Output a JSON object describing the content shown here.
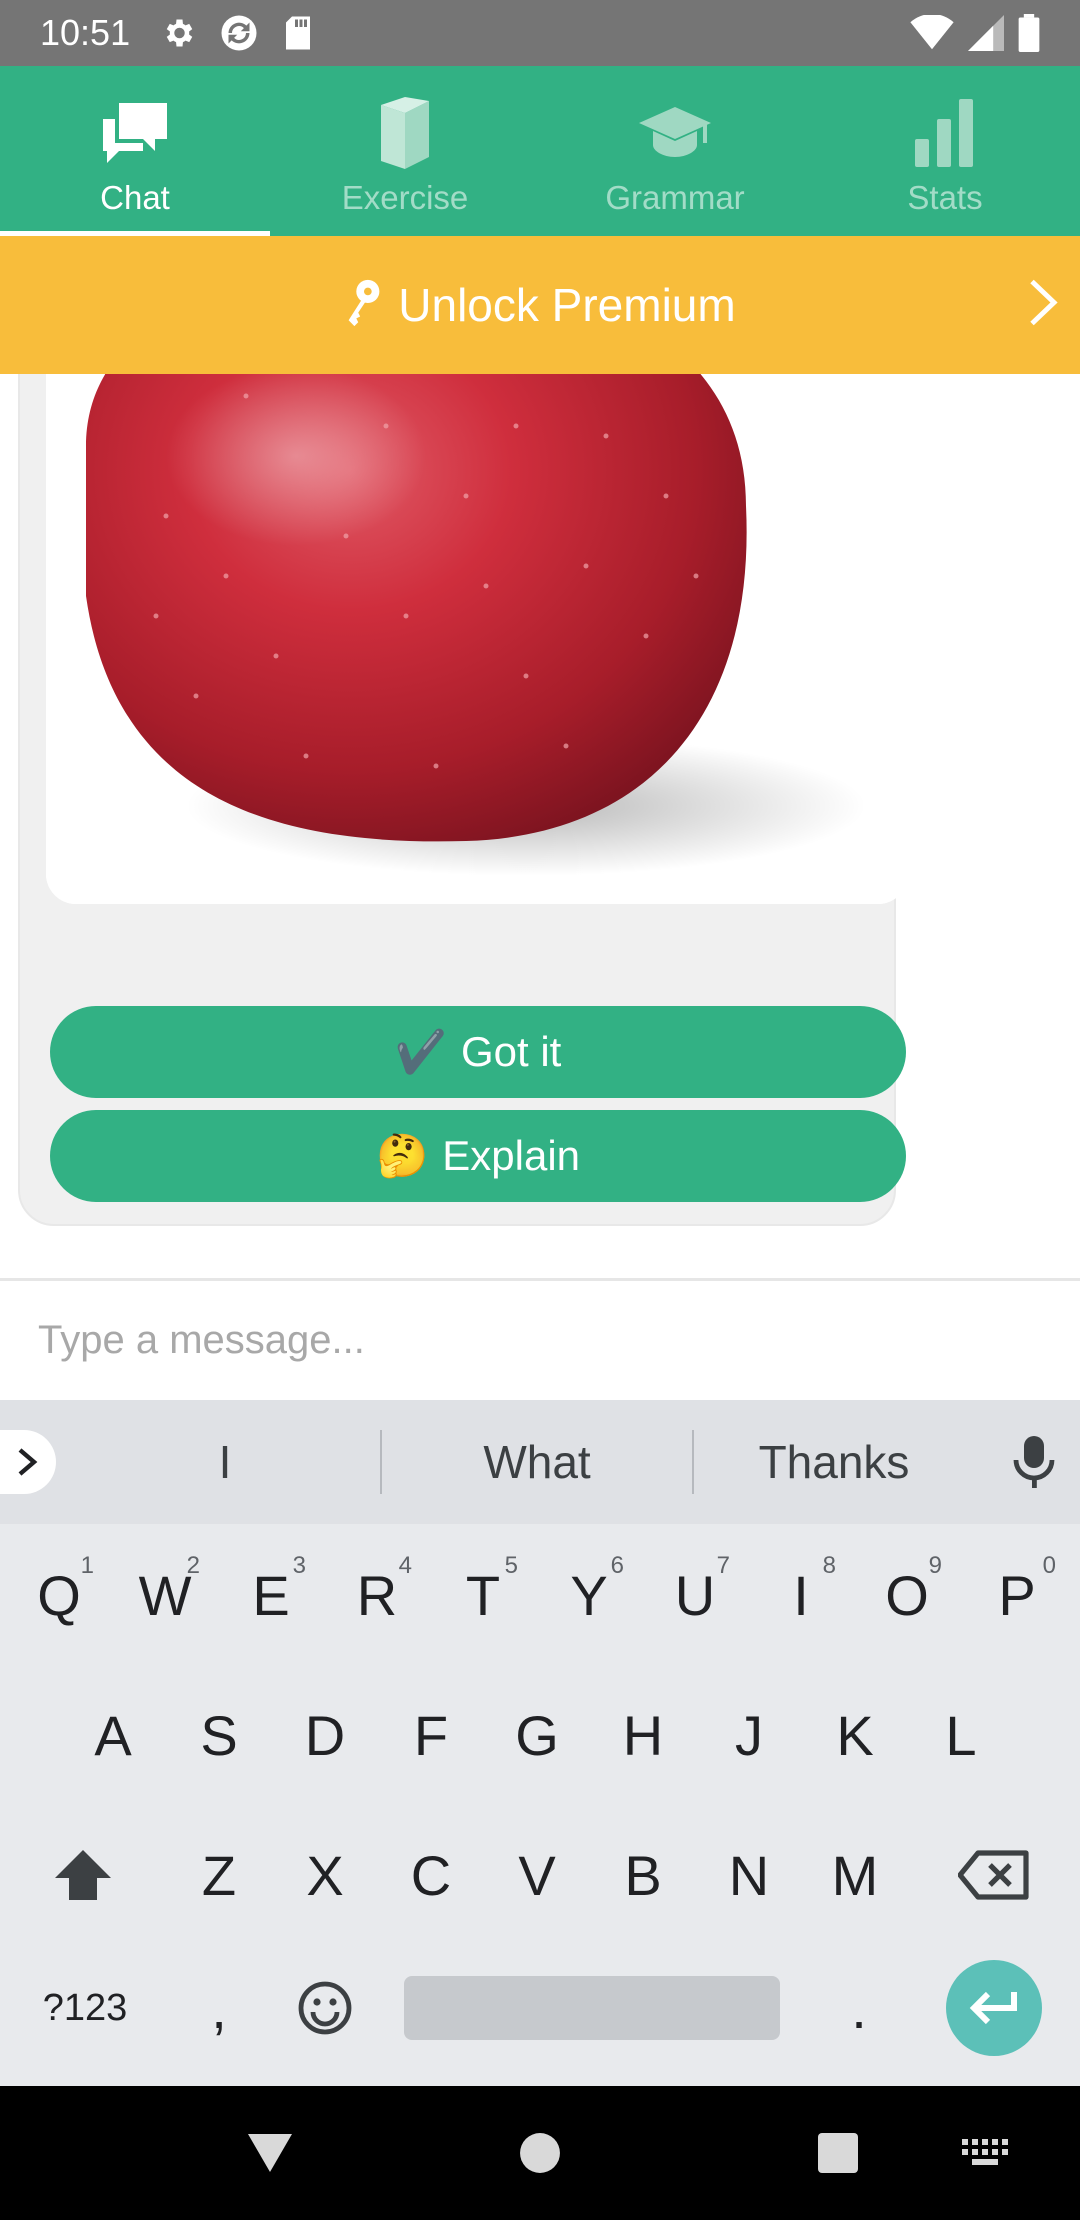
{
  "status_bar": {
    "time": "10:51",
    "icons_left": [
      "gear-icon",
      "sync-icon",
      "sd-card-icon"
    ],
    "icons_right": [
      "wifi-icon",
      "signal-icon",
      "battery-icon"
    ]
  },
  "nav": {
    "tabs": [
      {
        "label": "Chat",
        "icon": "chat-bubbles-icon",
        "active": true
      },
      {
        "label": "Exercise",
        "icon": "book-icon",
        "active": false
      },
      {
        "label": "Grammar",
        "icon": "graduation-cap-icon",
        "active": false
      },
      {
        "label": "Stats",
        "icon": "bar-chart-icon",
        "active": false
      }
    ]
  },
  "premium": {
    "label": "Unlock Premium",
    "icon": "key-icon"
  },
  "chat": {
    "image_alt": "red apple",
    "buttons": {
      "got_it": {
        "emoji": "✔️",
        "label": "Got it"
      },
      "explain": {
        "emoji": "🤔",
        "label": "Explain"
      }
    }
  },
  "input": {
    "placeholder": "Type a message..."
  },
  "keyboard": {
    "suggestions": [
      "I",
      "What",
      "Thanks"
    ],
    "row1": [
      {
        "key": "Q",
        "hint": "1"
      },
      {
        "key": "W",
        "hint": "2"
      },
      {
        "key": "E",
        "hint": "3"
      },
      {
        "key": "R",
        "hint": "4"
      },
      {
        "key": "T",
        "hint": "5"
      },
      {
        "key": "Y",
        "hint": "6"
      },
      {
        "key": "U",
        "hint": "7"
      },
      {
        "key": "I",
        "hint": "8"
      },
      {
        "key": "O",
        "hint": "9"
      },
      {
        "key": "P",
        "hint": "0"
      }
    ],
    "row2": [
      "A",
      "S",
      "D",
      "F",
      "G",
      "H",
      "J",
      "K",
      "L"
    ],
    "row3": [
      "Z",
      "X",
      "C",
      "V",
      "B",
      "N",
      "M"
    ],
    "symbols_label": "?123",
    "comma": ",",
    "period": "."
  },
  "colors": {
    "brand_green": "#32b184",
    "premium_yellow": "#f8bd3b",
    "enter_teal": "#5cc0b8"
  }
}
